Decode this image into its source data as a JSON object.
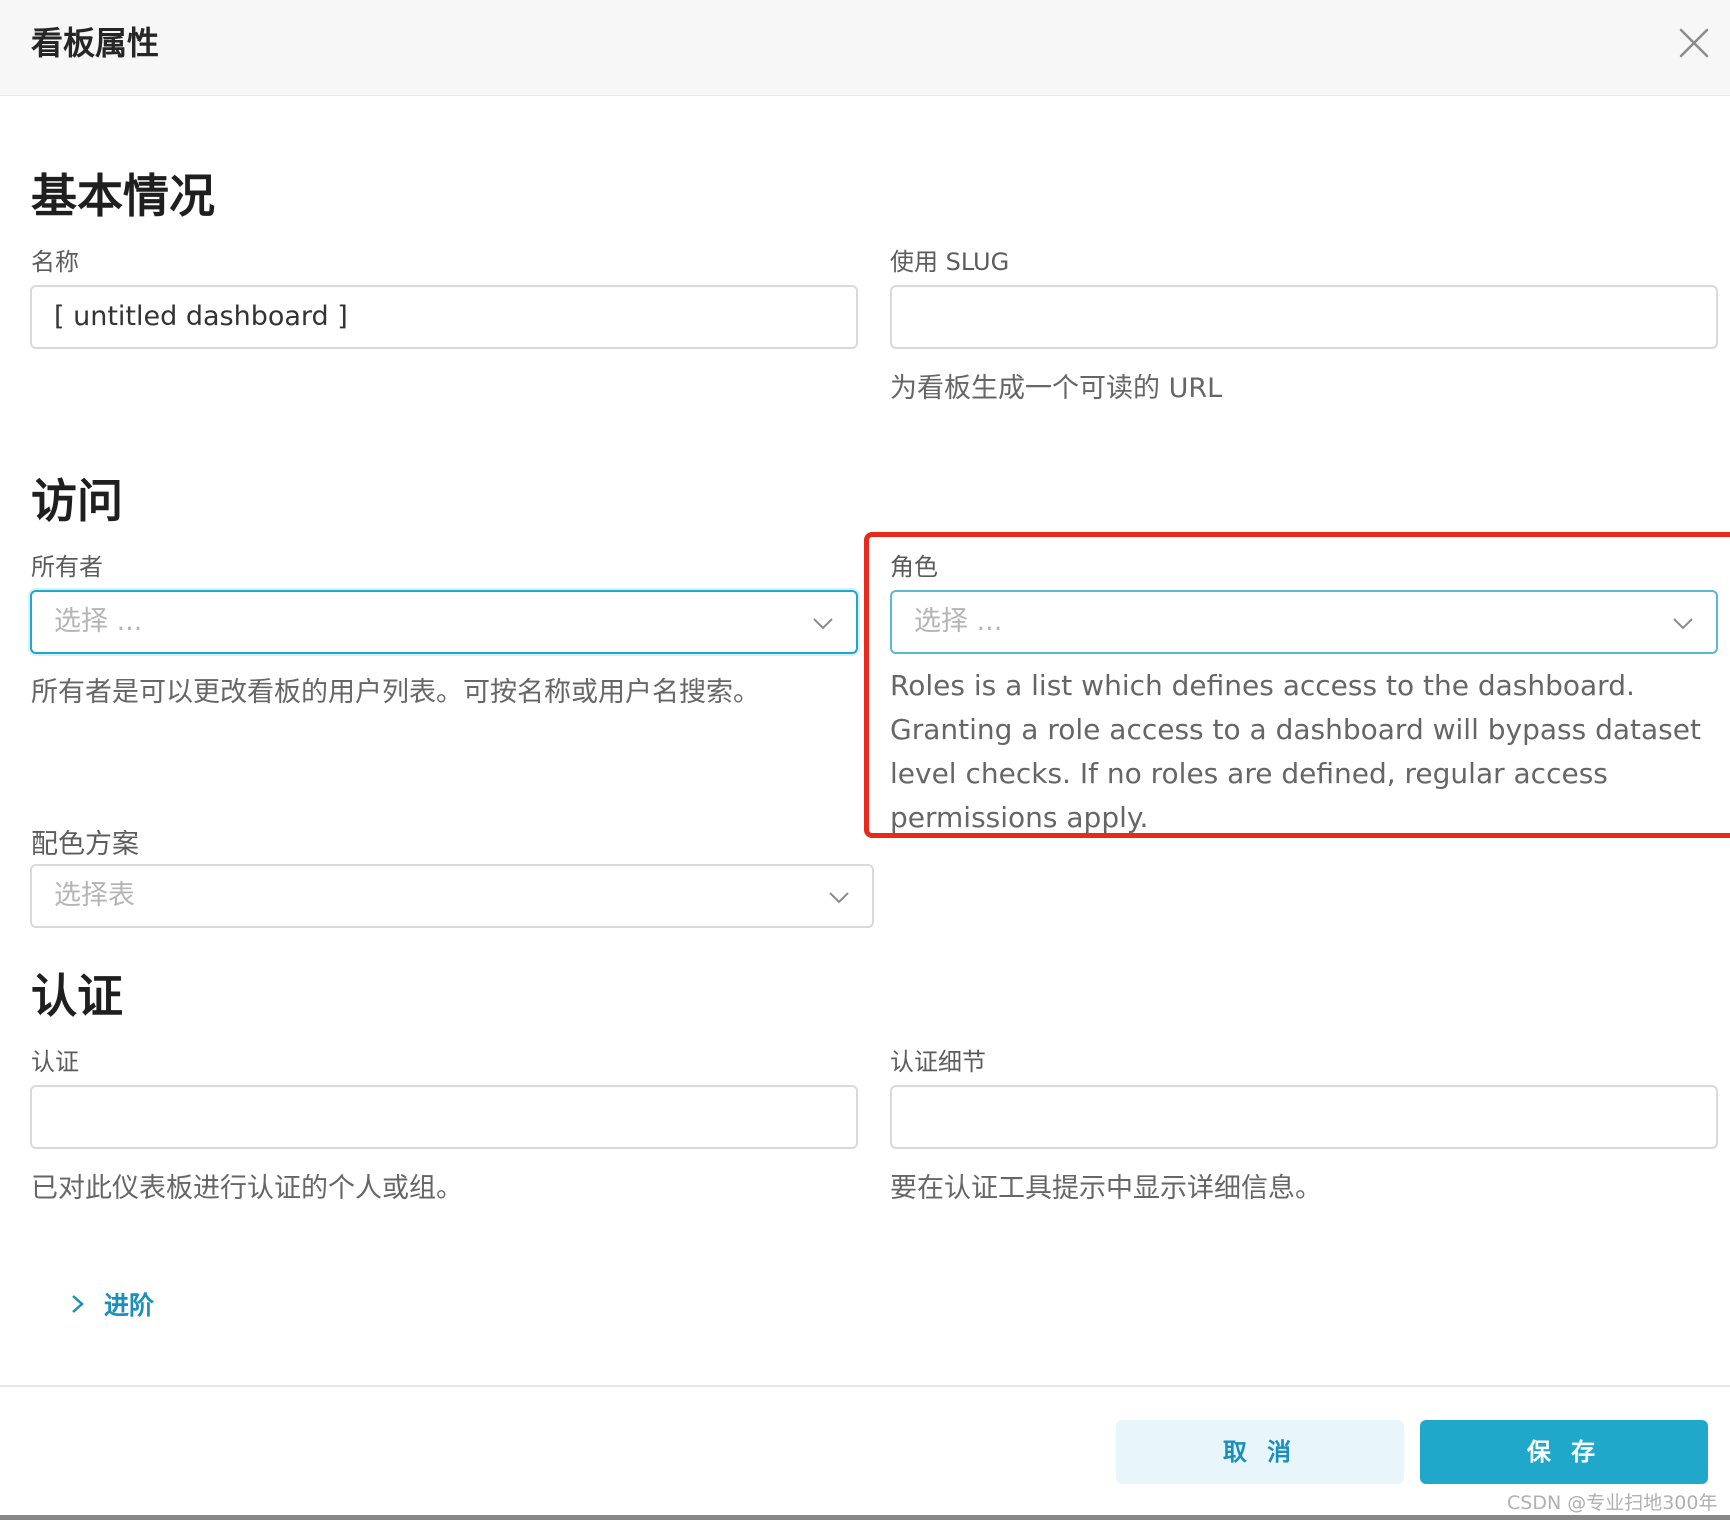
{
  "modal": {
    "title": "看板属性"
  },
  "basic": {
    "title": "基本情况",
    "name_label": "名称",
    "name_value": "[ untitled dashboard ]",
    "slug_label": "使用 SLUG",
    "slug_value": "",
    "slug_help": "为看板生成一个可读的 URL"
  },
  "access": {
    "title": "访问",
    "owners_label": "所有者",
    "owners_placeholder": "选择 ...",
    "owners_help": "所有者是可以更改看板的用户列表。可按名称或用户名搜索。",
    "roles_label": "角色",
    "roles_placeholder": "选择 ...",
    "roles_help": "Roles is a list which defines access to the dashboard. Granting a role access to a dashboard will bypass dataset level checks. If no roles are defined, regular access permissions apply.",
    "color_label": "配色方案",
    "color_placeholder": "选择表"
  },
  "certification": {
    "title": "认证",
    "certified_by_label": "认证",
    "certified_by_value": "",
    "certified_by_help": "已对此仪表板进行认证的个人或组。",
    "details_label": "认证细节",
    "details_value": "",
    "details_help": "要在认证工具提示中显示详细信息。"
  },
  "advanced": {
    "label": "进阶"
  },
  "footer": {
    "cancel_label": "取 消",
    "save_label": "保 存"
  },
  "watermark": "CSDN @专业扫地300年",
  "colors": {
    "accent": "#1fa8c9",
    "highlight": "#e8291c",
    "cancel_bg": "#e8f5fa"
  },
  "icons": {
    "close": "close-icon",
    "chevron": "chevron-down-icon",
    "expand": "chevron-right-icon"
  }
}
